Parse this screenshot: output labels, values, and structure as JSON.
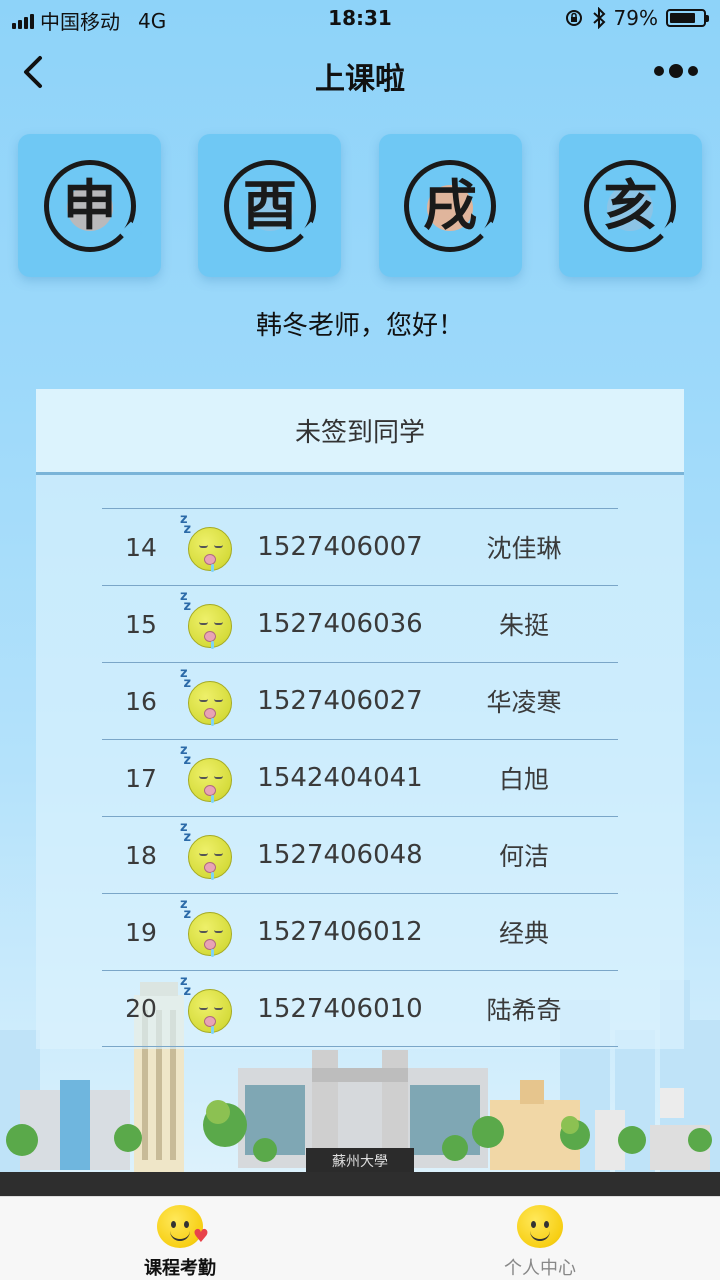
{
  "status_bar": {
    "carrier": "中国移动",
    "network": "4G",
    "time": "18:31",
    "battery": "79%",
    "battery_level": 0.79
  },
  "nav": {
    "title": "上课啦",
    "back_icon": "chevron-left-icon",
    "more_icon": "more-dots-icon"
  },
  "zodiac_tiles": [
    {
      "glyph": "申",
      "accent": "#b9b9bb"
    },
    {
      "glyph": "酉",
      "accent": "#8cc4e6"
    },
    {
      "glyph": "戌",
      "accent": "#e0b59c"
    },
    {
      "glyph": "亥",
      "accent": "#8cc4e6"
    }
  ],
  "greeting": "韩冬老师，您好！",
  "absent_card": {
    "title": "未签到同学",
    "students": [
      {
        "num": "14",
        "id": "1527406007",
        "name": "沈佳琳"
      },
      {
        "num": "15",
        "id": "1527406036",
        "name": "朱挺"
      },
      {
        "num": "16",
        "id": "1527406027",
        "name": "华凌寒"
      },
      {
        "num": "17",
        "id": "1542404041",
        "name": "白旭"
      },
      {
        "num": "18",
        "id": "1527406048",
        "name": "何洁"
      },
      {
        "num": "19",
        "id": "1527406012",
        "name": "经典"
      },
      {
        "num": "20",
        "id": "1527406010",
        "name": "陆希奇"
      }
    ]
  },
  "city": {
    "gate_sign": "蘇州大學"
  },
  "tab_bar": {
    "tabs": [
      {
        "label": "课程考勤",
        "active": true
      },
      {
        "label": "个人中心",
        "active": false
      }
    ]
  },
  "colors": {
    "accent_tile": "#6fc8f4",
    "background_top": "#8ed3f9",
    "divider": "#7aa6c8"
  }
}
